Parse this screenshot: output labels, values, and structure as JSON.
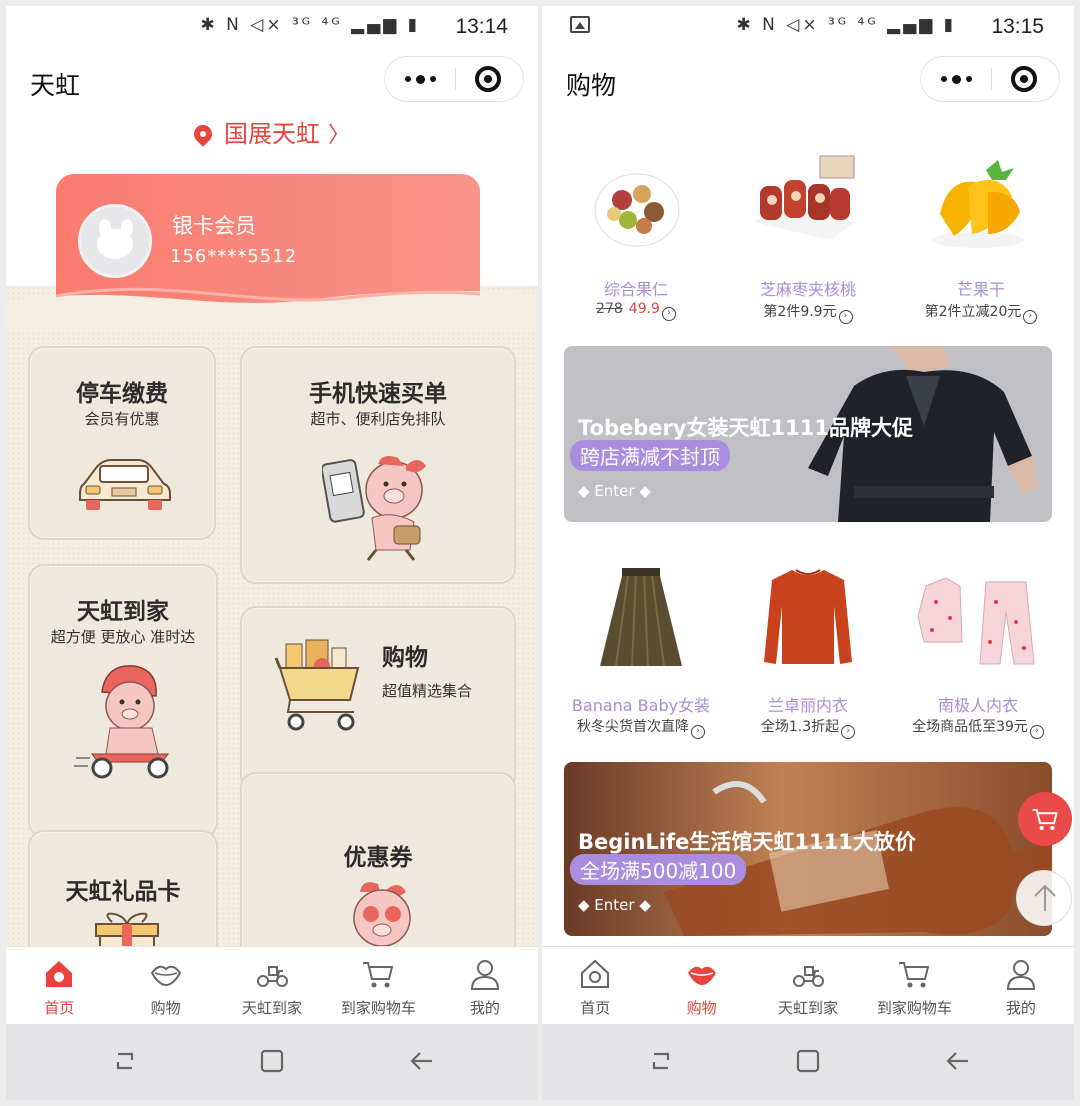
{
  "left": {
    "status": {
      "icons": "✱ N ◁× ³ᴳ ⁴ᴳ ▂▄▆ ▮",
      "time": "13:14"
    },
    "title": "天虹",
    "location": "国展天虹",
    "member": {
      "tier": "银卡会员",
      "phone": "156****5512"
    },
    "tiles": [
      {
        "title": "停车缴费",
        "subtitle": "会员有优惠"
      },
      {
        "title": "手机快速买单",
        "subtitle": "超市、便利店免排队"
      },
      {
        "title": "天虹到家",
        "subtitle": "超方便 更放心 准时达"
      },
      {
        "title": "购物",
        "subtitle": "超值精选集合"
      },
      {
        "title": "天虹礼品卡",
        "subtitle": ""
      },
      {
        "title": "优惠券",
        "subtitle": ""
      }
    ],
    "nav": [
      {
        "label": "首页",
        "icon": "home-icon",
        "active": true
      },
      {
        "label": "购物",
        "icon": "lips-icon",
        "active": false
      },
      {
        "label": "天虹到家",
        "icon": "scooter-icon",
        "active": false
      },
      {
        "label": "到家购物车",
        "icon": "cart-icon",
        "active": false
      },
      {
        "label": "我的",
        "icon": "user-icon",
        "active": false
      }
    ]
  },
  "right": {
    "status": {
      "icons": "✱ N ◁× ³ᴳ ⁴ᴳ ▂▄▆ ▮",
      "time": "13:15"
    },
    "title": "购物",
    "products_row1": [
      {
        "name": "综合果仁",
        "old_price": "278",
        "price": "49.9",
        "promo": ""
      },
      {
        "name": "芝麻枣夹核桃",
        "promo": "第2件9.9元"
      },
      {
        "name": "芒果干",
        "promo": "第2件立减20元"
      }
    ],
    "banner1": {
      "title": "Tobebery女装天虹1111品牌大促",
      "tag": "跨店满减不封顶",
      "enter": "◆ Enter ◆"
    },
    "products_row2": [
      {
        "name": "Banana Baby女装",
        "promo": "秋冬尖货首次直降"
      },
      {
        "name": "兰卓丽内衣",
        "promo": "全场1.3折起"
      },
      {
        "name": "南极人内衣",
        "promo": "全场商品低至39元"
      }
    ],
    "banner2": {
      "title": "BeginLife生活馆天虹1111大放价",
      "tag": "全场满500减100",
      "enter": "◆ Enter ◆"
    },
    "nav": [
      {
        "label": "首页",
        "icon": "home-icon",
        "active": false
      },
      {
        "label": "购物",
        "icon": "lips-icon",
        "active": true
      },
      {
        "label": "天虹到家",
        "icon": "scooter-icon",
        "active": false
      },
      {
        "label": "到家购物车",
        "icon": "cart-icon",
        "active": false
      },
      {
        "label": "我的",
        "icon": "user-icon",
        "active": false
      }
    ]
  },
  "colors": {
    "accent": "#e8433c",
    "lavender": "#a98dd3",
    "card": "#fb7b6f"
  }
}
